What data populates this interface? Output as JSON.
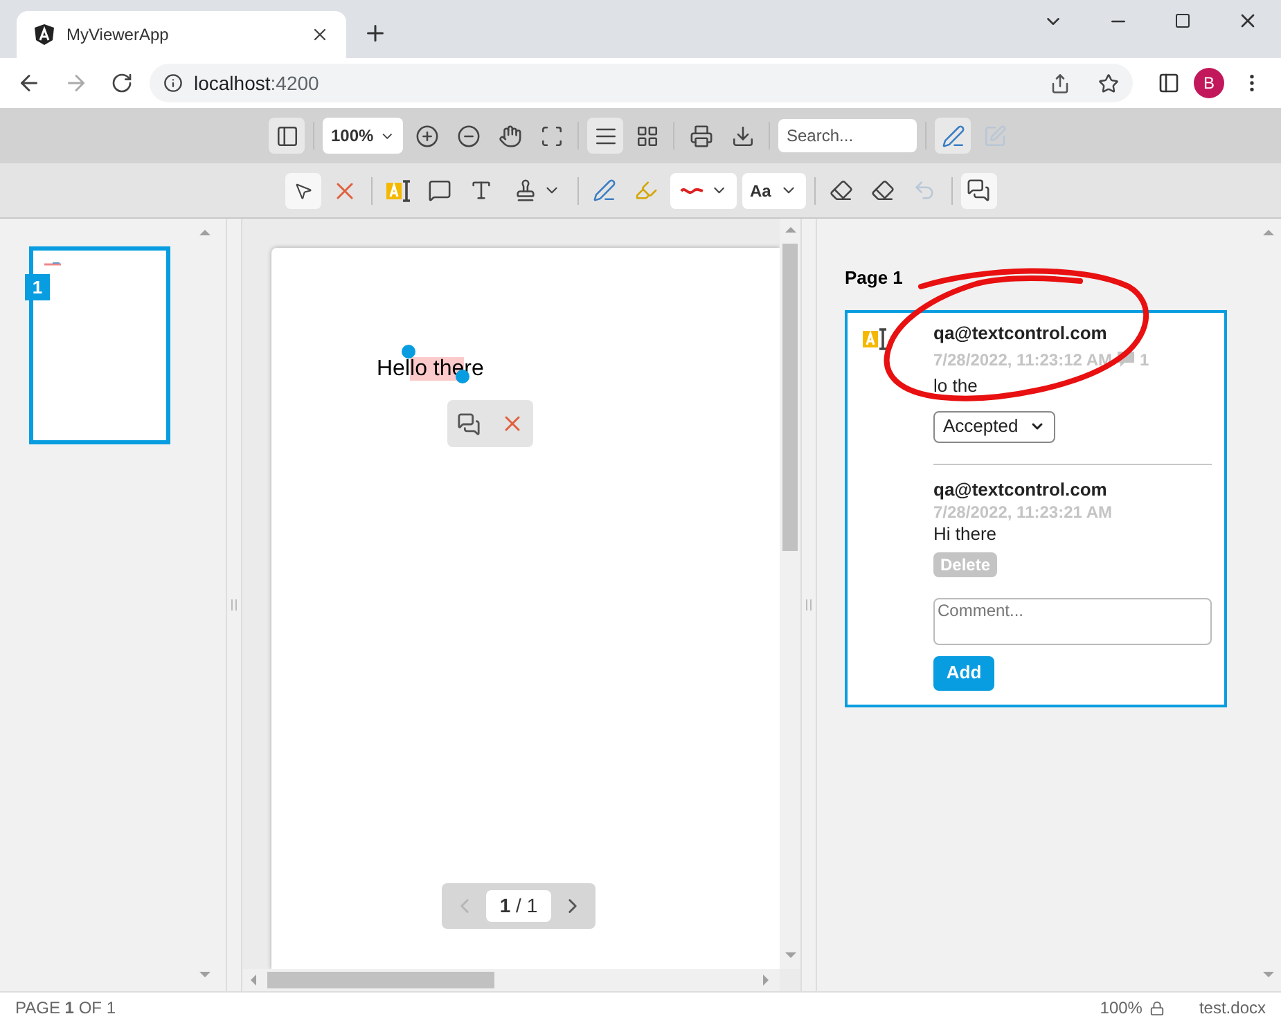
{
  "browser": {
    "tab_title": "MyViewerApp",
    "url_host": "localhost",
    "url_port": ":4200",
    "profile_initial": "B"
  },
  "toolbar_top": [
    [
      {
        "kind": "sidebar",
        "selected": true,
        "disabled": false
      }
    ],
    [
      {
        "kind": "zoom",
        "value": "100%"
      },
      {
        "kind": "zoom-in",
        "selected": false,
        "disabled": false
      },
      {
        "kind": "zoom-out",
        "selected": false,
        "disabled": false
      },
      {
        "kind": "pan",
        "selected": false,
        "disabled": false
      },
      {
        "kind": "fit",
        "selected": false,
        "disabled": false
      }
    ],
    [
      {
        "kind": "single-page",
        "selected": true,
        "disabled": false
      },
      {
        "kind": "grid",
        "selected": false,
        "disabled": false
      }
    ],
    [
      {
        "kind": "print",
        "selected": false,
        "disabled": false
      },
      {
        "kind": "download",
        "selected": false,
        "disabled": false
      }
    ],
    [
      {
        "kind": "search",
        "placeholder": "Search..."
      }
    ],
    [
      {
        "kind": "sign",
        "selected": true,
        "disabled": false
      },
      {
        "kind": "edit-form",
        "selected": false,
        "disabled": true
      }
    ]
  ],
  "toolbar_annotations": [
    [
      {
        "kind": "pointer",
        "selected": true,
        "disabled": false
      },
      {
        "kind": "delete",
        "selected": false,
        "disabled": false
      }
    ],
    [
      {
        "kind": "text-highlight",
        "selected": false,
        "disabled": false
      },
      {
        "kind": "comment",
        "selected": false,
        "disabled": false
      },
      {
        "kind": "text",
        "selected": false,
        "disabled": false
      },
      {
        "kind": "stamp",
        "selected": false,
        "disabled": false
      }
    ],
    [
      {
        "kind": "pen",
        "selected": false,
        "disabled": false
      },
      {
        "kind": "highlighter",
        "selected": false,
        "disabled": false
      },
      {
        "kind": "ink-color",
        "selected": false,
        "disabled": false
      },
      {
        "kind": "font",
        "value": "Aa"
      }
    ],
    [
      {
        "kind": "eraser",
        "selected": false,
        "disabled": false
      },
      {
        "kind": "erase-all",
        "selected": false,
        "disabled": false
      },
      {
        "kind": "undo",
        "selected": false,
        "disabled": true
      }
    ],
    [
      {
        "kind": "comments",
        "selected": true,
        "disabled": false
      }
    ]
  ],
  "thumbnails": [
    {
      "page_number": "1",
      "selected": true
    }
  ],
  "document": {
    "text_before": "Hel",
    "highlighted": "lo the",
    "text_after": "re"
  },
  "pager": {
    "label": "**1** / 1",
    "previous_disabled": true
  },
  "comments_panel": {
    "page_heading": "Page 1",
    "comment": {
      "author": "qa@textcontrol.com",
      "date": "7/28/2022, 11:23:12 AM",
      "reply_count": "1",
      "text": "lo the",
      "status": "Accepted",
      "replies": [
        {
          "author": "qa@textcontrol.com",
          "date": "7/28/2022, 11:23:21 AM",
          "text": "Hi there",
          "delete_label": "Delete",
          "delete_disabled": true
        }
      ],
      "input_placeholder": "Comment...",
      "add_label": "Add"
    }
  },
  "status_bar": {
    "page": "PAGE **1** OF 1",
    "zoom": "100%",
    "file": "test.docx"
  }
}
